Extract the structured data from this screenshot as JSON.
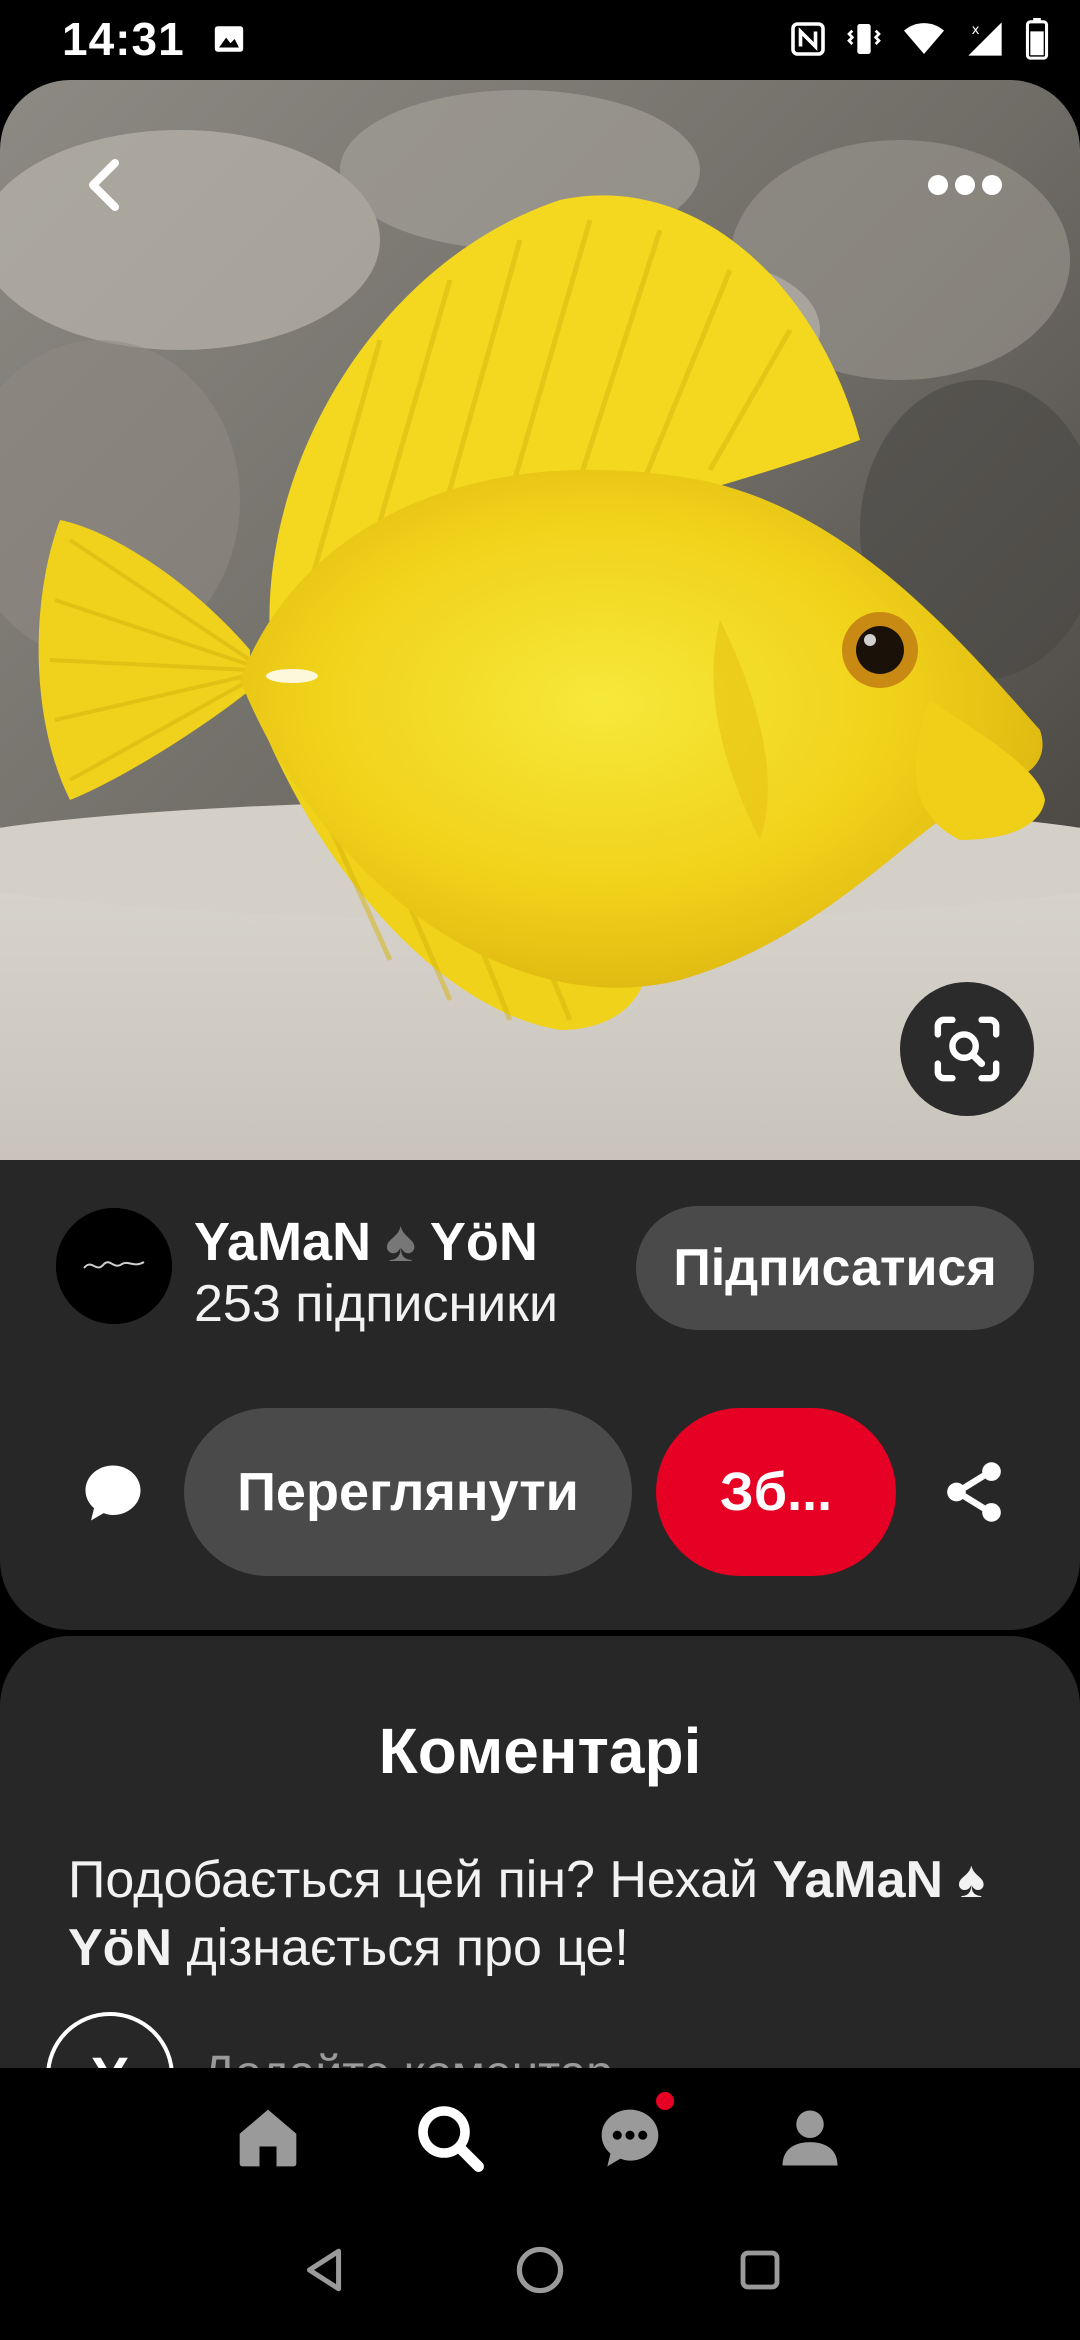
{
  "status_bar": {
    "time": "14:31",
    "left_icons": [
      "image-icon"
    ],
    "right_icons": [
      "nfc-icon",
      "vibrate-icon",
      "wifi-icon",
      "signal-icon",
      "battery-icon"
    ]
  },
  "pin": {
    "image_alt": "Yellow tang fish",
    "icons": {
      "back": "chevron-left-icon",
      "more": "more-horizontal-icon",
      "lens": "visual-search-icon"
    }
  },
  "author": {
    "name_part1": "YaMaN",
    "name_symbol": "♠",
    "name_part2": "YöN",
    "followers": "253 підписники",
    "follow_label": "Підписатися"
  },
  "actions": {
    "view_label": "Переглянути",
    "save_label": "Зб...",
    "icons": {
      "comment": "comment-icon",
      "share": "share-icon"
    }
  },
  "comments": {
    "title": "Коментарі",
    "prompt_before": "Подобається цей пін? Нехай ",
    "prompt_name": "YaMaN ♠ YöN",
    "prompt_after": " дізнається про це!",
    "avatar_letter": "Y",
    "input_placeholder": "Додайте коментар"
  },
  "bottom_nav": [
    {
      "icon": "home-icon",
      "active": false
    },
    {
      "icon": "search-icon",
      "active": true
    },
    {
      "icon": "messages-icon",
      "active": false,
      "badge": true
    },
    {
      "icon": "profile-icon",
      "active": false
    }
  ],
  "system_nav": [
    "back-triangle-icon",
    "home-circle-icon",
    "recents-square-icon"
  ],
  "colors": {
    "accent": "#e60023",
    "card": "#272727",
    "pill": "#4a4a4a"
  }
}
